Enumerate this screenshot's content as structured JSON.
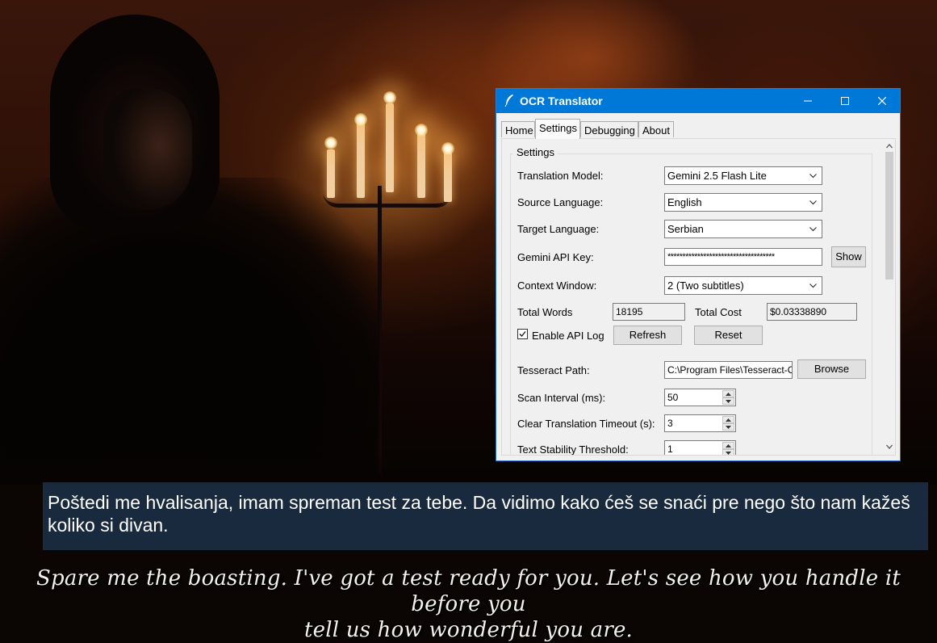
{
  "app": {
    "title": "OCR Translator",
    "tabs": [
      "Home",
      "Settings",
      "Debugging",
      "About"
    ],
    "active_tab": "Settings",
    "settings": {
      "group_label": "Settings",
      "translation_model": {
        "label": "Translation Model:",
        "value": "Gemini 2.5 Flash Lite"
      },
      "source_language": {
        "label": "Source Language:",
        "value": "English"
      },
      "target_language": {
        "label": "Target Language:",
        "value": "Serbian"
      },
      "api_key": {
        "label": "Gemini API Key:",
        "value": "************************************",
        "show_label": "Show"
      },
      "context_window": {
        "label": "Context Window:",
        "value": "2 (Two subtitles)"
      },
      "total_words": {
        "label": "Total Words",
        "value": "18195"
      },
      "total_cost": {
        "label": "Total Cost",
        "value": "$0.03338890"
      },
      "enable_api_log": {
        "label": "Enable API Log",
        "checked": true
      },
      "refresh_label": "Refresh",
      "reset_label": "Reset",
      "tesseract_path": {
        "label": "Tesseract Path:",
        "value": "C:\\Program Files\\Tesseract-OCR\\tesseract.exe",
        "browse_label": "Browse"
      },
      "scan_interval": {
        "label": "Scan Interval (ms):",
        "value": "50"
      },
      "clear_timeout": {
        "label": "Clear Translation Timeout (s):",
        "value": "3"
      },
      "stability_threshold": {
        "label": "Text Stability Threshold:",
        "value": "1"
      }
    }
  },
  "overlay": {
    "translated_text": "Poštedi me hvalisanja, imam spreman test za tebe. Da vidimo kako ćeš se snaći pre nego što nam kažeš koliko si divan.",
    "background_color": "#1a2a3e"
  },
  "game": {
    "subtitle_line1": "Spare me the boasting. I've got a test ready for you. Let's see how you handle it before you",
    "subtitle_line2": "tell us how wonderful you are."
  },
  "colors": {
    "titlebar": "#0078d7",
    "window_bg": "#f0f0f0"
  },
  "icons": [
    "quill-icon",
    "minimize-icon",
    "maximize-icon",
    "close-icon",
    "chevron-down-icon",
    "checkmark-icon"
  ]
}
